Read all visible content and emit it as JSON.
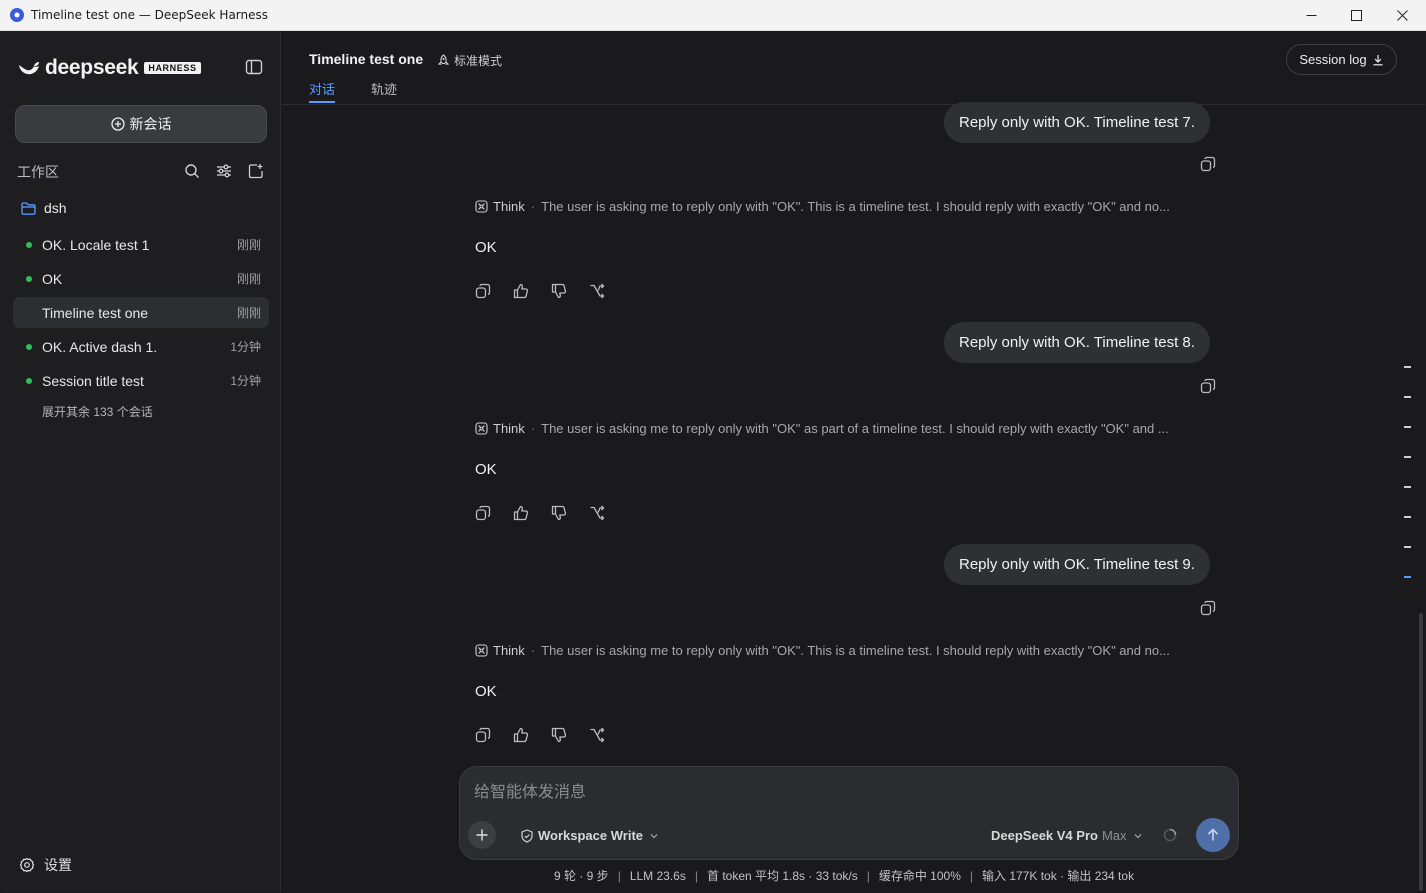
{
  "window": {
    "title": "Timeline test one — DeepSeek Harness"
  },
  "sidebar": {
    "brand": "deepseek",
    "brand_badge": "HARNESS",
    "new_chat_label": "新会话",
    "workspace_label": "工作区",
    "folder": "dsh",
    "sessions": [
      {
        "name": "OK. Locale test 1",
        "time": "刚刚",
        "status": "online"
      },
      {
        "name": "OK",
        "time": "刚刚",
        "status": "online"
      },
      {
        "name": "Timeline test one",
        "time": "刚刚",
        "status": "active"
      },
      {
        "name": "OK. Active dash 1.",
        "time": "1分钟",
        "status": "online"
      },
      {
        "name": "Session title test",
        "time": "1分钟",
        "status": "online"
      }
    ],
    "expand_more": "展开其余 133 个会话",
    "settings_label": "设置",
    "status_dot_color": "#2fbf5a"
  },
  "header": {
    "title": "Timeline test one",
    "mode": "标准模式",
    "tabs": [
      {
        "label": "对话",
        "selected": true
      },
      {
        "label": "轨迹",
        "selected": false
      }
    ],
    "session_log": "Session log",
    "accent": "#5b9bff"
  },
  "messages": [
    {
      "user": "Reply only with OK. Timeline test 7.",
      "think_label": "Think",
      "think_text": "The user is asking me to reply only with \"OK\". This is a timeline test. I should reply with exactly \"OK\" and no...",
      "reply": "OK"
    },
    {
      "user": "Reply only with OK. Timeline test 8.",
      "think_label": "Think",
      "think_text": "The user is asking me to reply only with \"OK\" as part of a timeline test. I should reply with exactly \"OK\" and ...",
      "reply": "OK"
    },
    {
      "user": "Reply only with OK. Timeline test 9.",
      "think_label": "Think",
      "think_text": "The user is asking me to reply only with \"OK\". This is a timeline test. I should reply with exactly \"OK\" and no...",
      "reply": "OK"
    }
  ],
  "composer": {
    "placeholder": "给智能体发消息",
    "value": "",
    "permission": "Workspace Write",
    "model": "DeepSeek V4 Pro",
    "model_tier": "Max"
  },
  "status_bar": {
    "turns": "9 轮 · 9 步",
    "llm": "LLM 23.6s",
    "first_token": "首 token 平均 1.8s · 33 tok/s",
    "cache": "缓存命中 100%",
    "tokens": "输入 177K tok · 输出 234 tok"
  }
}
